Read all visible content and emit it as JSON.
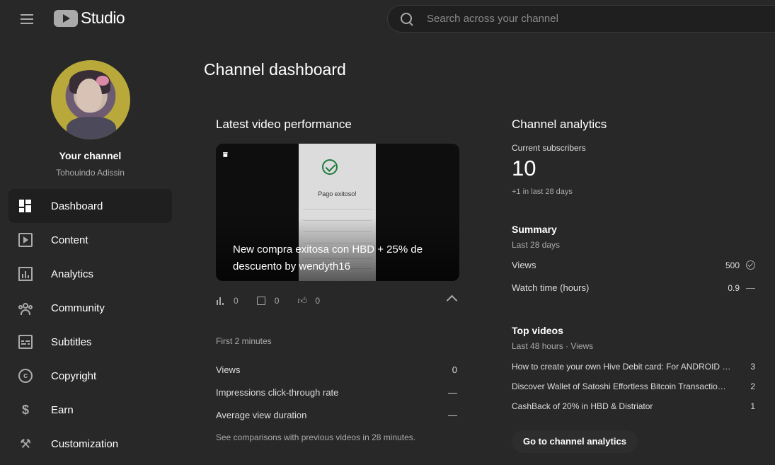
{
  "header": {
    "logo_text": "Studio",
    "search_placeholder": "Search across your channel"
  },
  "sidebar": {
    "channel_label": "Your channel",
    "channel_name": "Tohouindo Adissin",
    "items": [
      {
        "label": "Dashboard",
        "icon": "dashboard-icon",
        "active": true
      },
      {
        "label": "Content",
        "icon": "content-icon"
      },
      {
        "label": "Analytics",
        "icon": "analytics-icon"
      },
      {
        "label": "Community",
        "icon": "community-icon"
      },
      {
        "label": "Subtitles",
        "icon": "subtitles-icon"
      },
      {
        "label": "Copyright",
        "icon": "copyright-icon"
      },
      {
        "label": "Earn",
        "icon": "earn-icon"
      },
      {
        "label": "Customization",
        "icon": "customization-icon"
      }
    ]
  },
  "main": {
    "page_title": "Channel dashboard",
    "latest": {
      "title": "Latest video performance",
      "video_title": "New compra exitosa con HBD + 25% de descuento by wendyth16",
      "thumb_text": "Pago exitoso!",
      "stats": {
        "views": "0",
        "comments": "0",
        "likes": "0"
      },
      "period": "First 2 minutes",
      "metrics": [
        {
          "label": "Views",
          "value": "0"
        },
        {
          "label": "Impressions click-through rate",
          "value": "—"
        },
        {
          "label": "Average view duration",
          "value": "—"
        }
      ],
      "note": "See comparisons with previous videos in 28 minutes."
    },
    "analytics": {
      "title": "Channel analytics",
      "subs_label": "Current subscribers",
      "subs_count": "10",
      "subs_delta": "+1 in last 28 days",
      "summary_title": "Summary",
      "summary_period": "Last 28 days",
      "summary": [
        {
          "label": "Views",
          "value": "500"
        },
        {
          "label": "Watch time (hours)",
          "value": "0.9"
        }
      ],
      "top_title": "Top videos",
      "top_period": "Last 48 hours · Views",
      "top_videos": [
        {
          "title": "How to create your own Hive Debit card: For ANDROID …",
          "views": "3"
        },
        {
          "title": "Discover Wallet of Satoshi Effortless Bitcoin Transactio…",
          "views": "2"
        },
        {
          "title": "CashBack of 20% in HBD & Distriator",
          "views": "1"
        }
      ],
      "button": "Go to channel analytics"
    }
  }
}
